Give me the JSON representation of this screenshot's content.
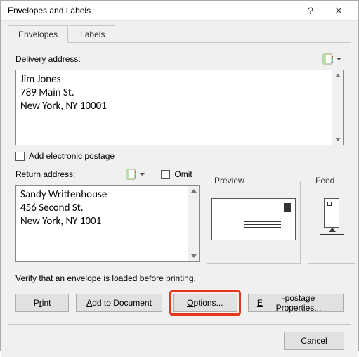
{
  "window": {
    "title": "Envelopes and Labels"
  },
  "tabs": {
    "envelopes": "Envelopes",
    "labels": "Labels"
  },
  "delivery": {
    "label": "Delivery address:",
    "text": "Jim Jones\n789 Main St.\nNew York, NY 10001"
  },
  "electronic": {
    "label": "Add electronic postage"
  },
  "return": {
    "label": "Return address:",
    "omit": "Omit",
    "text": "Sandy Writtenhouse\n456 Second St.\nNew York, NY 1001"
  },
  "preview": {
    "label": "Preview"
  },
  "feed": {
    "label": "Feed"
  },
  "verify": "Verify that an envelope is loaded before printing.",
  "buttons": {
    "print_pre": "P",
    "print_u": "r",
    "print_post": "int",
    "add_pre": "",
    "add_u": "A",
    "add_post": "dd to Document",
    "options_pre": "",
    "options_u": "O",
    "options_post": "ptions...",
    "epost_pre": "",
    "epost_u": "E",
    "epost_post": "-postage Properties...",
    "cancel": "Cancel"
  }
}
